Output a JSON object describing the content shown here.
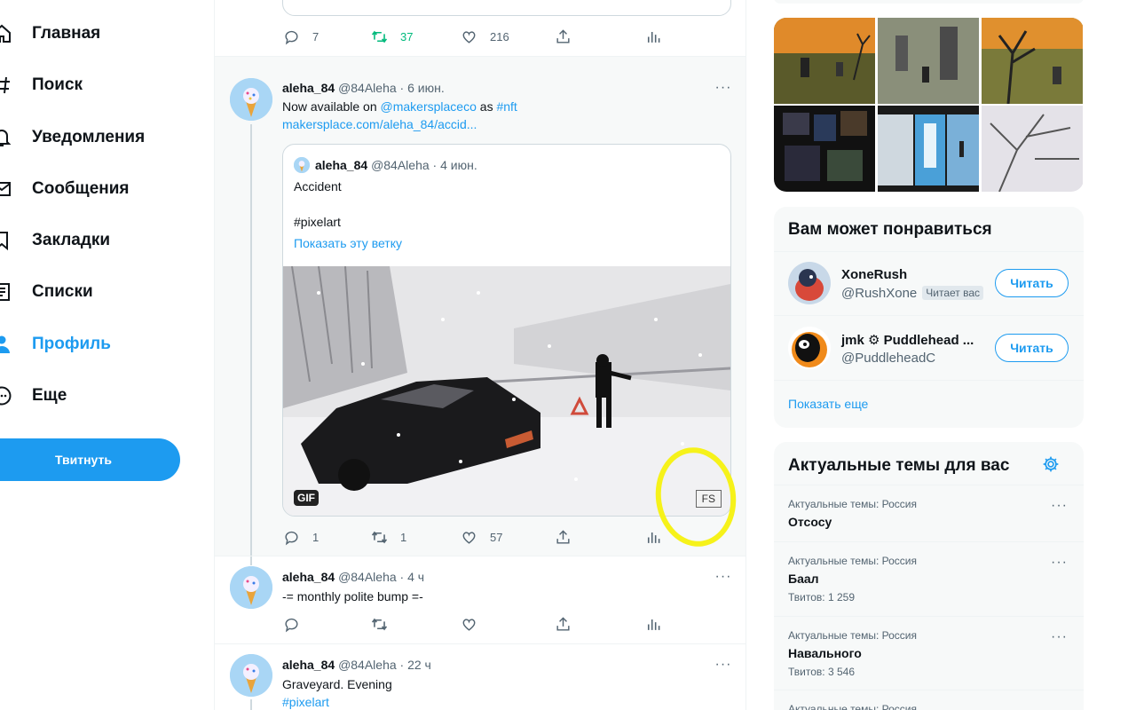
{
  "nav": {
    "items": [
      {
        "label": "Главная",
        "icon": "home-icon"
      },
      {
        "label": "Поиск",
        "icon": "hashtag-icon"
      },
      {
        "label": "Уведомления",
        "icon": "bell-icon"
      },
      {
        "label": "Сообщения",
        "icon": "envelope-icon"
      },
      {
        "label": "Закладки",
        "icon": "bookmark-icon"
      },
      {
        "label": "Списки",
        "icon": "list-icon"
      },
      {
        "label": "Профиль",
        "icon": "person-icon",
        "active": true
      },
      {
        "label": "Еще",
        "icon": "more-circle-icon"
      }
    ],
    "tweet_button": "Твитнуть"
  },
  "colors": {
    "accent": "#1d9bf0",
    "retweet_active": "#00ba7c",
    "highlight_circle": "#f6f21a"
  },
  "timeline": {
    "top_tweet": {
      "replies": "7",
      "retweets": "37",
      "likes": "216"
    },
    "tweet1": {
      "name": "aleha_84",
      "handle_time": "@84Aleha · 6 июн.",
      "text_prefix": "Now available on",
      "mention": "@makersplaceco",
      "text_mid": "as",
      "hashtag": "#nft",
      "url": "makersplace.com/aleha_84/accid...",
      "quote": {
        "name": "aleha_84",
        "handle_time": "@84Aleha · 4 июн.",
        "line1": "Accident",
        "line2": "#pixelart",
        "show_thread": "Показать эту ветку",
        "gif_badge": "GIF",
        "fs_badge": "FS"
      },
      "replies": "1",
      "retweets": "1",
      "likes": "57"
    },
    "tweet2": {
      "name": "aleha_84",
      "handle_time": "@84Aleha · 4 ч",
      "text": "-= monthly polite bump =-"
    },
    "tweet3": {
      "name": "aleha_84",
      "handle_time": "@84Aleha · 22 ч",
      "text": "Graveyard. Evening",
      "hashtag": "#pixelart"
    }
  },
  "who_to_follow": {
    "title": "Вам может понравиться",
    "users": [
      {
        "name": "XoneRush",
        "handle": "@RushXone",
        "follows_you": "Читает вас",
        "button": "Читать"
      },
      {
        "name": "jmk ⚙ Puddlehead ...",
        "handle": "@PuddleheadC",
        "button": "Читать"
      }
    ],
    "show_more": "Показать еще"
  },
  "trends": {
    "title": "Актуальные темы для вас",
    "items": [
      {
        "context": "Актуальные темы: Россия",
        "name": "Отсосу",
        "count": ""
      },
      {
        "context": "Актуальные темы: Россия",
        "name": "Баал",
        "count": "Твитов: 1 259"
      },
      {
        "context": "Актуальные темы: Россия",
        "name": "Навального",
        "count": "Твитов: 3 546"
      },
      {
        "context": "Актуальные темы: Россия",
        "name": "",
        "count": ""
      }
    ]
  }
}
